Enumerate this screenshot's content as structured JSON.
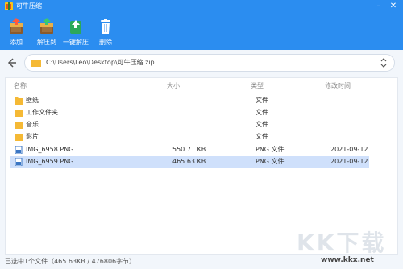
{
  "app": {
    "title": "可牛压缩",
    "logo_icon": "app-logo-icon",
    "window_controls": [
      "minimize-icon",
      "close-icon"
    ]
  },
  "toolbar": {
    "buttons": [
      {
        "label": "添加",
        "icon": "add-icon"
      },
      {
        "label": "解压到",
        "icon": "extract-to-icon"
      },
      {
        "label": "一键解压",
        "icon": "one-click-extract-icon"
      },
      {
        "label": "删除",
        "icon": "delete-icon"
      }
    ]
  },
  "path_bar": {
    "path": "C:\\Users\\Leo\\Desktop\\可牛压缩.zip"
  },
  "file_list": {
    "columns": [
      "名称",
      "大小",
      "类型",
      "修改时间"
    ],
    "rows": [
      {
        "name": "壁纸",
        "size": "",
        "type": "文件",
        "modified": "",
        "icon": "folder-icon",
        "selected": false
      },
      {
        "name": "工作文件夹",
        "size": "",
        "type": "文件",
        "modified": "",
        "icon": "folder-icon",
        "selected": false
      },
      {
        "name": "音乐",
        "size": "",
        "type": "文件",
        "modified": "",
        "icon": "folder-icon",
        "selected": false
      },
      {
        "name": "影片",
        "size": "",
        "type": "文件",
        "modified": "",
        "icon": "folder-icon",
        "selected": false
      },
      {
        "name": "IMG_6958.PNG",
        "size": "550.71 KB",
        "type": "PNG 文件",
        "modified": "2021-09-12",
        "icon": "image-file-icon",
        "selected": false
      },
      {
        "name": "IMG_6959.PNG",
        "size": "465.63 KB",
        "type": "PNG 文件",
        "modified": "2021-09-12",
        "icon": "image-file-icon",
        "selected": true
      }
    ]
  },
  "status": {
    "text": "已选中1个文件（465.63KB / 476806字节）"
  },
  "watermark": {
    "text": "KK下载",
    "url": "www.kkx.net"
  },
  "colors": {
    "header": "#2b8df0",
    "selected_row": "#cfe0fb",
    "folder": "#f5b935"
  }
}
